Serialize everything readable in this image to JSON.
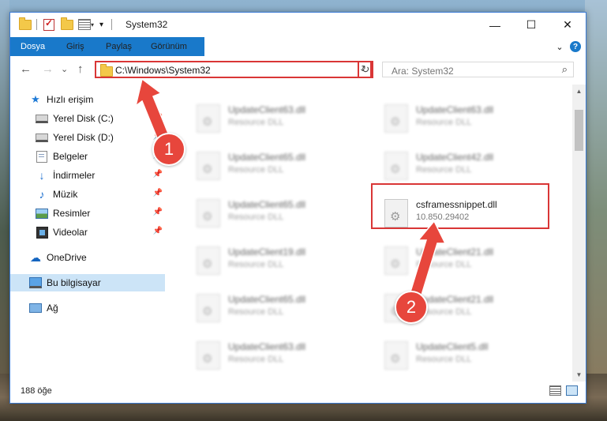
{
  "window": {
    "title": "System32",
    "quick_access_dropdown": "▾",
    "minimize": "—",
    "maximize": "☐",
    "close": "✕"
  },
  "ribbon": {
    "tabs": [
      {
        "label": "Dosya"
      },
      {
        "label": "Giriş"
      },
      {
        "label": "Paylaş"
      },
      {
        "label": "Görünüm"
      }
    ],
    "expand_icon": "⌄",
    "help_icon": "?"
  },
  "nav": {
    "back": "←",
    "forward": "→",
    "recent": "⌄",
    "up": "↑",
    "address": "C:\\Windows\\System32",
    "address_dropdown": "⌄",
    "refresh": "↻",
    "search_placeholder": "Ara: System32",
    "search_icon": "⌕"
  },
  "sidebar": {
    "items": [
      {
        "label": "Hızlı erişim",
        "icon": "star-icon"
      },
      {
        "label": "Yerel Disk (C:)",
        "icon": "drive-icon",
        "pinned": true
      },
      {
        "label": "Yerel Disk (D:)",
        "icon": "drive-icon",
        "pinned": true
      },
      {
        "label": "Belgeler",
        "icon": "documents-icon",
        "pinned": true
      },
      {
        "label": "İndirmeler",
        "icon": "download-icon",
        "pinned": true
      },
      {
        "label": "Müzik",
        "icon": "music-icon",
        "pinned": true
      },
      {
        "label": "Resimler",
        "icon": "pictures-icon",
        "pinned": true
      },
      {
        "label": "Videolar",
        "icon": "videos-icon",
        "pinned": true
      },
      {
        "label": "OneDrive",
        "icon": "cloud-icon"
      },
      {
        "label": "Bu bilgisayar",
        "icon": "computer-icon",
        "selected": true
      },
      {
        "label": "Ağ",
        "icon": "network-icon"
      }
    ],
    "pin_glyph": "📌"
  },
  "files": [
    {
      "name": "UpdateClient63.dll",
      "desc": "Resource DLL"
    },
    {
      "name": "UpdateClient63.dll",
      "desc": "Resource DLL"
    },
    {
      "name": "UpdateClient65.dll",
      "desc": "Resource DLL"
    },
    {
      "name": "UpdateClient42.dll",
      "desc": "Resource DLL"
    },
    {
      "name": "UpdateClient65.dll",
      "desc": "Resource DLL"
    },
    {
      "name": "csframessnippet.dll",
      "desc": "10.850.29402",
      "highlighted": true
    },
    {
      "name": "UpdateClient19.dll",
      "desc": "Resource DLL"
    },
    {
      "name": "UpdateClient21.dll",
      "desc": "Resource DLL"
    },
    {
      "name": "UpdateClient65.dll",
      "desc": "Resource DLL"
    },
    {
      "name": "UpdateClient21.dll",
      "desc": "Resource DLL"
    },
    {
      "name": "UpdateClient63.dll",
      "desc": "Resource DLL"
    },
    {
      "name": "UpdateClient5.dll",
      "desc": "Resource DLL"
    }
  ],
  "status": {
    "count": "188 öğe"
  },
  "annotations": {
    "badge1": "1",
    "badge2": "2",
    "color": "#e7463c"
  }
}
